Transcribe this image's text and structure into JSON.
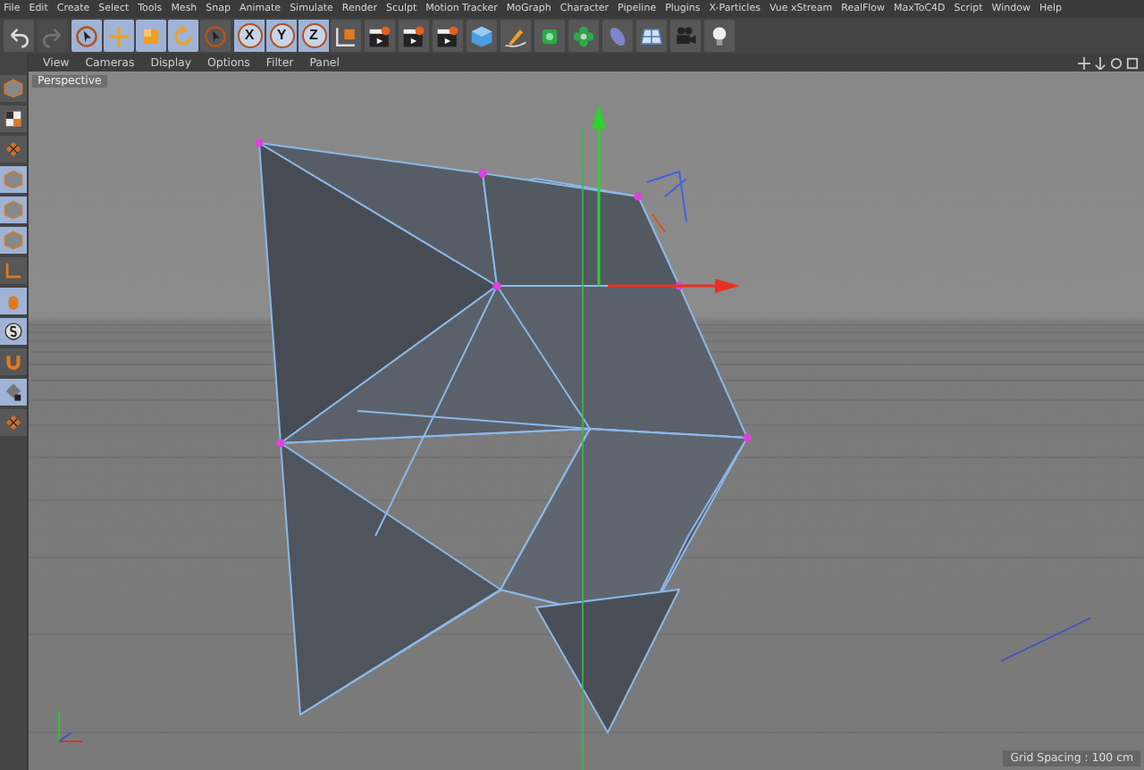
{
  "menu_bar": [
    "File",
    "Edit",
    "Create",
    "Select",
    "Tools",
    "Mesh",
    "Snap",
    "Animate",
    "Simulate",
    "Render",
    "Sculpt",
    "Motion Tracker",
    "MoGraph",
    "Character",
    "Pipeline",
    "Plugins",
    "X-Particles",
    "Vue xStream",
    "RealFlow",
    "MaxToC4D",
    "Script",
    "Window",
    "Help"
  ],
  "toolbar": [
    {
      "kind": "undo",
      "selected": false,
      "disabled": false
    },
    {
      "kind": "redo",
      "selected": false,
      "disabled": true
    },
    {
      "kind": "select",
      "selected": true,
      "disabled": false
    },
    {
      "kind": "move",
      "selected": true,
      "disabled": false
    },
    {
      "kind": "scale",
      "selected": true,
      "disabled": false
    },
    {
      "kind": "rotate",
      "selected": true,
      "disabled": false
    },
    {
      "kind": "select",
      "selected": false,
      "disabled": false
    },
    {
      "kind": "axis",
      "label": "X",
      "selected": true,
      "disabled": false
    },
    {
      "kind": "axis",
      "label": "Y",
      "selected": true,
      "disabled": false
    },
    {
      "kind": "axis",
      "label": "Z",
      "selected": true,
      "disabled": false
    },
    {
      "kind": "coords",
      "selected": false,
      "disabled": false
    },
    {
      "kind": "render",
      "selected": false,
      "disabled": false
    },
    {
      "kind": "render",
      "selected": false,
      "disabled": false
    },
    {
      "kind": "render",
      "selected": false,
      "disabled": false
    },
    {
      "kind": "cube",
      "selected": false,
      "disabled": false
    },
    {
      "kind": "pen",
      "selected": false,
      "disabled": false
    },
    {
      "kind": "gear",
      "selected": false,
      "disabled": false
    },
    {
      "kind": "flower",
      "selected": false,
      "disabled": false
    },
    {
      "kind": "capsule",
      "selected": false,
      "disabled": false
    },
    {
      "kind": "plane",
      "selected": false,
      "disabled": false
    },
    {
      "kind": "camera",
      "selected": false,
      "disabled": false
    },
    {
      "kind": "bulb",
      "selected": false,
      "disabled": false
    }
  ],
  "viewport": {
    "menu": [
      "View",
      "Cameras",
      "Display",
      "Options",
      "Filter",
      "Panel"
    ],
    "camera_label": "Perspective",
    "grid_spacing": "Grid Spacing : 100 cm"
  },
  "left_toolbar": [
    {
      "selected": false
    },
    {
      "selected": false
    },
    {
      "selected": false
    },
    {
      "selected": true
    },
    {
      "selected": true
    },
    {
      "selected": true
    },
    {
      "selected": false
    },
    {
      "selected": true
    },
    {
      "selected": true
    },
    {
      "selected": false
    },
    {
      "selected": true
    },
    {
      "selected": false
    }
  ]
}
